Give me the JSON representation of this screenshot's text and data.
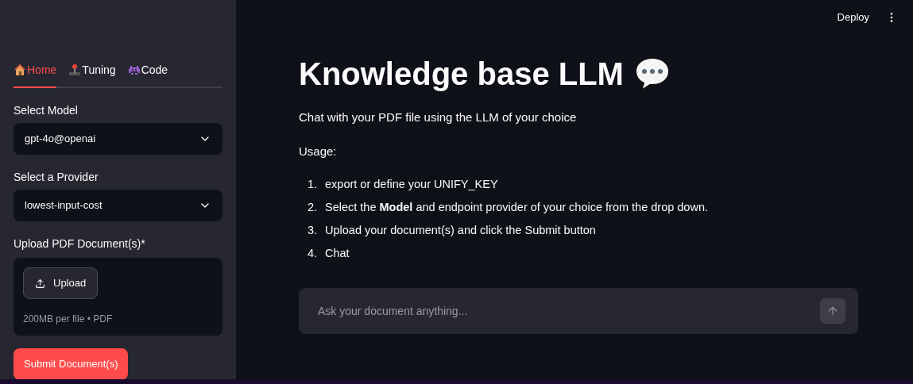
{
  "header": {
    "deploy": "Deploy"
  },
  "sidebar": {
    "tabs": [
      {
        "label": "Home",
        "selected": true
      },
      {
        "label": "Tuning",
        "selected": false
      },
      {
        "label": "Code",
        "selected": false
      }
    ],
    "model": {
      "label": "Select Model",
      "value": "gpt-4o@openai"
    },
    "provider": {
      "label": "Select a Provider",
      "value": "lowest-input-cost"
    },
    "upload": {
      "label": "Upload PDF Document(s)*",
      "button": "Upload",
      "hint": "200MB per file • PDF"
    },
    "submit": "Submit Document(s)"
  },
  "main": {
    "title": "Knowledge base LLM",
    "intro": "Chat with your PDF file using the LLM of your choice",
    "usage": "Usage:",
    "steps": [
      {
        "number": "1.",
        "text": "export or define your UNIFY_KEY"
      },
      {
        "number": "2.",
        "text": "Select the **Model** and endpoint provider of your choice from the drop down."
      },
      {
        "number": "3.",
        "text": "Upload your document(s) and click the Submit button"
      },
      {
        "number": "4.",
        "text": "Chat"
      }
    ],
    "chat": {
      "placeholder": "Ask your document anything..."
    }
  }
}
